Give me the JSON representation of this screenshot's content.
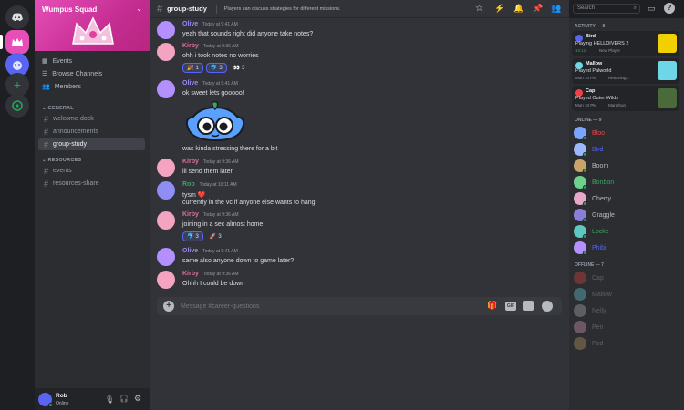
{
  "server": {
    "name": "Wumpus Squad",
    "nav": [
      "Events",
      "Browse Channels",
      "Members"
    ]
  },
  "categories": {
    "general": {
      "label": "GENERAL",
      "channels": [
        "welcome-dock",
        "announcements",
        "group-study"
      ]
    },
    "resources": {
      "label": "RESOURCES",
      "channels": [
        "events",
        "resources-share"
      ]
    }
  },
  "user": {
    "name": "Rob",
    "status": "Online"
  },
  "header": {
    "channel": "group-study",
    "topic": "Players can discuss strategies for different missions.",
    "search_placeholder": "Search"
  },
  "messages": [
    {
      "author": "Olive",
      "time": "Today at 9:41 AM",
      "text": "yeah that sounds right did anyone take notes?",
      "color": "#3ba55d"
    },
    {
      "author": "Kirby",
      "time": "Today at 9:36 AM",
      "text": "ohh i took notes no worries",
      "color": "#e06c9f",
      "reactions": [
        {
          "emoji": "🎉",
          "count": "1"
        },
        {
          "emoji": "🐬",
          "count": "3"
        },
        {
          "emoji": "👀",
          "count": "3"
        }
      ]
    },
    {
      "author": "Olive",
      "time": "Today at 9:41 AM",
      "text": "ok sweet lets gooooo!",
      "text2": "was kinda stressing there for a bit",
      "color": "#3ba55d"
    },
    {
      "author": "Kirby",
      "time": "Today at 9:36 AM",
      "text": "ill send them later",
      "color": "#e06c9f"
    },
    {
      "author": "Rob",
      "time": "Today at 10:11 AM",
      "text": "tysm ❤️",
      "text2": "currently in the vc if anyone else wants to hang",
      "color": "#3ba55d"
    },
    {
      "author": "Kirby",
      "time": "Today at 9:36 AM",
      "text": "joining in a sec almost home",
      "color": "#e06c9f",
      "reactions": [
        {
          "emoji": "🐬",
          "count": "3"
        },
        {
          "emoji": "🚀",
          "count": "3"
        }
      ]
    },
    {
      "author": "Olive",
      "time": "Today at 9:41 AM",
      "text": "same also anyone down to game later?",
      "color": "#3ba55d"
    },
    {
      "author": "Kirby",
      "time": "Today at 9:36 AM",
      "text": "Ohhh I could be down",
      "color": "#e06c9f"
    }
  ],
  "composer": {
    "placeholder": "Message #career-questions"
  },
  "activity": {
    "label": "ACTIVITY — 8",
    "items": [
      {
        "name": "Bird",
        "line1": "Playing HELLDIVERS 2",
        "badge": "16:12",
        "line2": "New Player",
        "color": "#f0d000"
      },
      {
        "name": "Mallow",
        "line1": "Played Palworld",
        "badge": "Mon 10 PM",
        "line2": "Returning...",
        "color": "#6fd6e8"
      },
      {
        "name": "Cap",
        "line1": "Played Outer Wilds",
        "badge": "Mon 10 PM",
        "line2": "Marathon",
        "color": "#4a6a3a"
      }
    ]
  },
  "online": {
    "label": "ONLINE — 9",
    "members": [
      {
        "name": "Bloo",
        "color": "#ed4245"
      },
      {
        "name": "Bird",
        "color": "#5865f2"
      },
      {
        "name": "Boom",
        "color": "#b5bac1"
      },
      {
        "name": "Bonbon",
        "color": "#3ba55d"
      },
      {
        "name": "Cherry",
        "color": "#b5bac1"
      },
      {
        "name": "Graggle",
        "color": "#b5bac1"
      },
      {
        "name": "Locke",
        "color": "#3ba55d"
      },
      {
        "name": "Phibi",
        "color": "#5865f2"
      }
    ]
  },
  "offline": {
    "label": "OFFLINE — 7",
    "members": [
      "Cap",
      "Mallow",
      "Nelly",
      "Pen",
      "Pod"
    ]
  }
}
